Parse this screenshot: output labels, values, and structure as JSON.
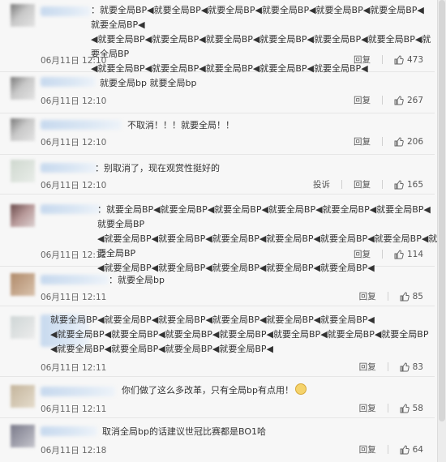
{
  "comments": [
    {
      "text": "：就要全局BP◀就要全局BP◀就要全局BP◀就要全局BP◀就要全局BP◀就要全局BP◀就要全局BP◀\n◀就要全局BP◀就要全局BP◀就要全局BP◀就要全局BP◀就要全局BP◀就要全局BP◀就要全局BP\n◀就要全局BP◀就要全局BP◀就要全局BP◀就要全局BP◀就要全局BP◀",
      "time": "06月11日 12:10",
      "reply": "回复",
      "likes": "473"
    },
    {
      "text": "就要全局bp 就要全局bp",
      "time": "06月11日 12:10",
      "reply": "回复",
      "likes": "267"
    },
    {
      "text": "不取消！！！就要全局！！",
      "time": "06月11日 12:10",
      "reply": "回复",
      "likes": "206"
    },
    {
      "text": "：别取消了，现在观赏性挺好的",
      "time": "06月11日 12:10",
      "report": "投诉",
      "reply": "回复",
      "likes": "165"
    },
    {
      "text": "：就要全局BP◀就要全局BP◀就要全局BP◀就要全局BP◀就要全局BP◀就要全局BP◀就要全局BP\n◀就要全局BP◀就要全局BP◀就要全局BP◀就要全局BP◀就要全局BP◀就要全局BP◀就要全局BP\n◀就要全局BP◀就要全局BP◀就要全局BP◀就要全局BP◀就要全局BP◀",
      "time": "06月11日 12:12",
      "reply": "回复",
      "likes": "114"
    },
    {
      "text": "：就要全局bp",
      "time": "06月11日 12:11",
      "reply": "回复",
      "likes": "85"
    },
    {
      "text": "就要全局BP◀就要全局BP◀就要全局BP◀就要全局BP◀就要全局BP◀就要全局BP◀\n◀就要全局BP◀就要全局BP◀就要全局BP◀就要全局BP◀就要全局BP◀就要全局BP◀就要全局BP\n◀就要全局BP◀就要全局BP◀就要全局BP◀就要全局BP◀",
      "time": "06月11日 12:11",
      "reply": "回复",
      "likes": "83"
    },
    {
      "text": "你们做了这么多改革，只有全局bp有点用！",
      "time": "06月11日 12:11",
      "reply": "回复",
      "likes": "58"
    },
    {
      "text": "取消全局bp的话建议世冠比赛都是BO1哈",
      "time": "06月11日 12:18",
      "reply": "回复",
      "likes": "64"
    }
  ]
}
